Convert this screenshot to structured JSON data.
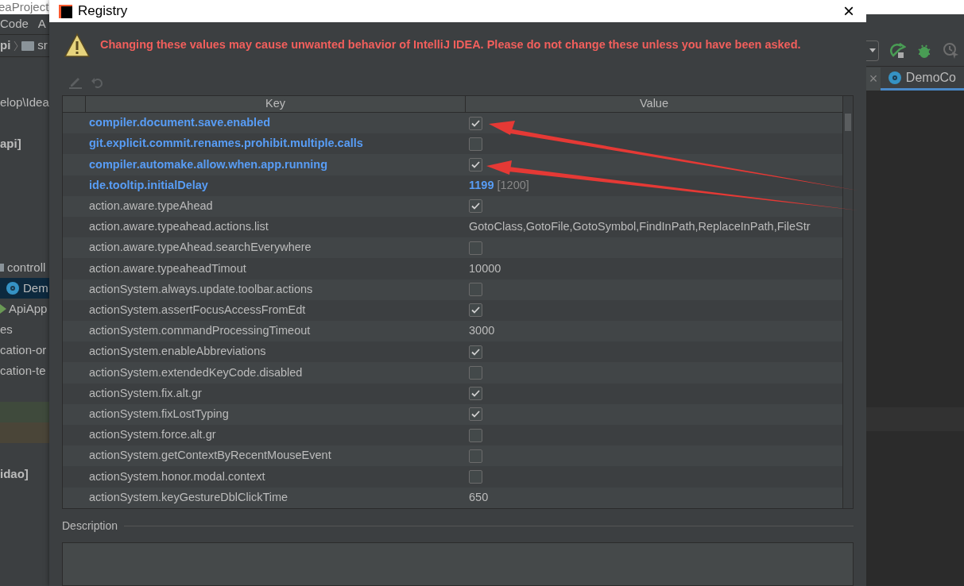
{
  "ide_left": {
    "title_fragment": "eaProject",
    "menu": [
      "Code",
      "A"
    ],
    "breadcrumb": [
      "pi",
      "sr"
    ],
    "tree": [
      {
        "kind": "text",
        "text": "elop\\Idea"
      },
      {
        "kind": "blank"
      },
      {
        "kind": "bold",
        "text": "api]"
      },
      {
        "kind": "blank"
      },
      {
        "kind": "blank"
      },
      {
        "kind": "blank"
      },
      {
        "kind": "blank"
      },
      {
        "kind": "blank"
      },
      {
        "kind": "folder",
        "text": "controll"
      },
      {
        "kind": "class",
        "text": "Dem",
        "selected": true
      },
      {
        "kind": "spring",
        "text": "ApiApp"
      },
      {
        "kind": "text",
        "text": "es"
      },
      {
        "kind": "text",
        "text": "cation-or"
      },
      {
        "kind": "text",
        "text": "cation-te"
      },
      {
        "kind": "blank"
      },
      {
        "kind": "highlight",
        "color": "#3f4a3c"
      },
      {
        "kind": "highlight",
        "color": "#4a4538"
      },
      {
        "kind": "blank"
      },
      {
        "kind": "bold",
        "text": "idao]"
      }
    ]
  },
  "ide_right": {
    "close": "×",
    "tab": "DemoCo"
  },
  "window": {
    "title": "Registry",
    "close": "×"
  },
  "warning": "Changing these values may cause unwanted behavior of IntelliJ IDEA. Please do not change these unless you have been asked.",
  "table": {
    "columns": [
      "Key",
      "Value"
    ],
    "rows": [
      {
        "key": "compiler.document.save.enabled",
        "modified": true,
        "kind": "checkbox",
        "checked": true
      },
      {
        "key": "git.explicit.commit.renames.prohibit.multiple.calls",
        "modified": true,
        "kind": "checkbox",
        "checked": false
      },
      {
        "key": "compiler.automake.allow.when.app.running",
        "modified": true,
        "kind": "checkbox",
        "checked": true
      },
      {
        "key": "ide.tooltip.initialDelay",
        "modified": true,
        "kind": "text",
        "value": "1199",
        "default": "[1200]"
      },
      {
        "key": "action.aware.typeAhead",
        "modified": false,
        "kind": "checkbox",
        "checked": true
      },
      {
        "key": "action.aware.typeahead.actions.list",
        "modified": false,
        "kind": "text",
        "value": "GotoClass,GotoFile,GotoSymbol,FindInPath,ReplaceInPath,FileStr"
      },
      {
        "key": "action.aware.typeAhead.searchEverywhere",
        "modified": false,
        "kind": "checkbox",
        "checked": false
      },
      {
        "key": "action.aware.typeaheadTimout",
        "modified": false,
        "kind": "text",
        "value": "10000"
      },
      {
        "key": "actionSystem.always.update.toolbar.actions",
        "modified": false,
        "kind": "checkbox",
        "checked": false
      },
      {
        "key": "actionSystem.assertFocusAccessFromEdt",
        "modified": false,
        "kind": "checkbox",
        "checked": true
      },
      {
        "key": "actionSystem.commandProcessingTimeout",
        "modified": false,
        "kind": "text",
        "value": "3000"
      },
      {
        "key": "actionSystem.enableAbbreviations",
        "modified": false,
        "kind": "checkbox",
        "checked": true
      },
      {
        "key": "actionSystem.extendedKeyCode.disabled",
        "modified": false,
        "kind": "checkbox",
        "checked": false
      },
      {
        "key": "actionSystem.fix.alt.gr",
        "modified": false,
        "kind": "checkbox",
        "checked": true
      },
      {
        "key": "actionSystem.fixLostTyping",
        "modified": false,
        "kind": "checkbox",
        "checked": true
      },
      {
        "key": "actionSystem.force.alt.gr",
        "modified": false,
        "kind": "checkbox",
        "checked": false
      },
      {
        "key": "actionSystem.getContextByRecentMouseEvent",
        "modified": false,
        "kind": "checkbox",
        "checked": false
      },
      {
        "key": "actionSystem.honor.modal.context",
        "modified": false,
        "kind": "checkbox",
        "checked": false
      },
      {
        "key": "actionSystem.keyGestureDblClickTime",
        "modified": false,
        "kind": "text",
        "value": "650"
      }
    ]
  },
  "description": {
    "label": "Description"
  }
}
